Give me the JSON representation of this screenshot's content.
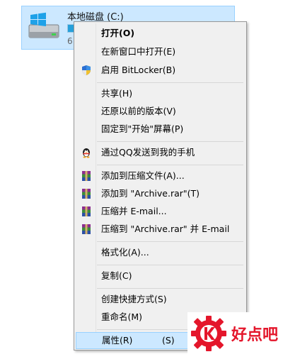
{
  "drive": {
    "label": "本地磁盘 (C:)",
    "sub": "6"
  },
  "menu": {
    "items": [
      {
        "label": "打开(O)",
        "icon": "",
        "bold": true
      },
      {
        "label": "在新窗口中打开(E)",
        "icon": ""
      },
      {
        "label": "启用 BitLocker(B)",
        "icon": "shield-icon"
      },
      {
        "label": "共享(H)",
        "icon": ""
      },
      {
        "label": "还原以前的版本(V)",
        "icon": ""
      },
      {
        "label": "固定到\"开始\"屏幕(P)",
        "icon": ""
      },
      {
        "label": "通过QQ发送到我的手机",
        "icon": "qq-penguin-icon"
      },
      {
        "label": "添加到压缩文件(A)...",
        "icon": "winrar-icon"
      },
      {
        "label": "添加到 \"Archive.rar\"(T)",
        "icon": "winrar-icon"
      },
      {
        "label": "压缩并 E-mail...",
        "icon": "winrar-icon"
      },
      {
        "label": "压缩到 \"Archive.rar\" 并 E-mail",
        "icon": "winrar-icon"
      },
      {
        "label": "格式化(A)...",
        "icon": ""
      },
      {
        "label": "复制(C)",
        "icon": ""
      },
      {
        "label": "创建快捷方式(S)",
        "icon": ""
      },
      {
        "label": "重命名(M)",
        "icon": ""
      },
      {
        "label": "属性(R)",
        "icon": "",
        "highlighted": true,
        "extra": "(S)"
      }
    ]
  },
  "watermark": {
    "text": "好点吧"
  },
  "colors": {
    "selection": "#cce8ff",
    "selection_border": "#99d1ff",
    "menu_bg": "#f0f0f0",
    "brand_red": "#e4162b"
  }
}
